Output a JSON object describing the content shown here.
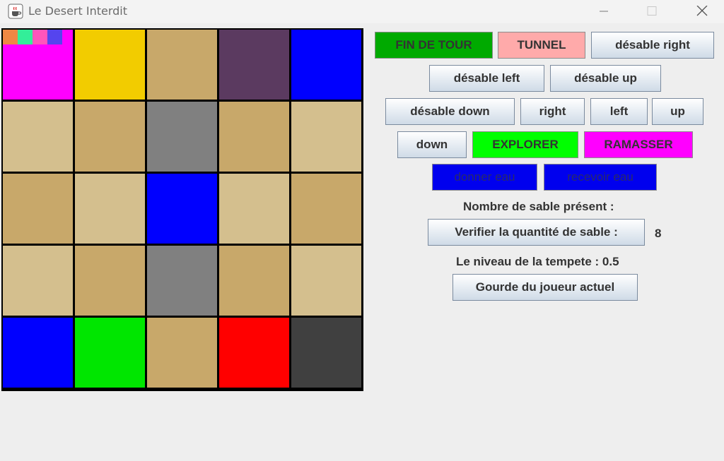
{
  "window": {
    "title": "Le Desert Interdit",
    "icon": "java-coffee-cup-icon",
    "minimize_icon": "minimize-icon",
    "maximize_icon": "maximize-icon",
    "close_icon": "close-icon"
  },
  "board": {
    "rows": [
      [
        "#ff00ff",
        "#f2cc00",
        "#c8a86a",
        "#5b3a60",
        "#0000ff"
      ],
      [
        "#d4bf8e",
        "#c8a86a",
        "#808080",
        "#c8a86a",
        "#d4bf8e"
      ],
      [
        "#c8a86a",
        "#d4bf8e",
        "#0000ff",
        "#d4bf8e",
        "#c8a86a"
      ],
      [
        "#d4bf8e",
        "#c8a86a",
        "#808080",
        "#c8a86a",
        "#d4bf8e"
      ],
      [
        "#0000ff",
        "#00e600",
        "#c8a86a",
        "#ff0000",
        "#404040"
      ]
    ],
    "players": [
      "#ee8844",
      "#33ee99",
      "#ff55bb",
      "#5544ee"
    ]
  },
  "buttons": {
    "fin_de_tour": "FIN DE TOUR",
    "tunnel": "TUNNEL",
    "desable_right": "désable right",
    "desable_left": "désable left",
    "desable_up": "désable up",
    "desable_down": "désable down",
    "right": "right",
    "left": "left",
    "up": "up",
    "down": "down",
    "explorer": "EXPLORER",
    "ramasser": "RAMASSER",
    "donner_eau": "donner eau",
    "recevoir_eau": "recevoir eau",
    "verifier_sable": "Verifier la quantité de sable :",
    "gourde": "Gourde du joueur actuel"
  },
  "info": {
    "sable_present": "Nombre de sable présent :",
    "sable_value": "8",
    "tempete": "Le niveau de la tempete : 0.5"
  },
  "colors": {
    "fin_de_tour_bg": "#00aa00",
    "tunnel_bg": "#ffaaaa",
    "explorer_bg": "#00ff00",
    "ramasser_bg": "#ff00ff",
    "eau_bg": "#0000ee"
  }
}
